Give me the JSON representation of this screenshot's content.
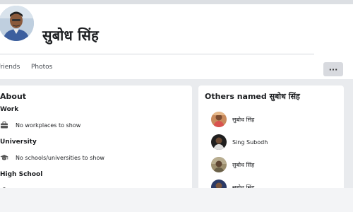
{
  "profile": {
    "name": "सुबोध सिंह"
  },
  "nav": {
    "friends_label": "Friends",
    "photos_label": "Photos",
    "more_label": "···"
  },
  "about": {
    "title": "About",
    "sections": [
      {
        "heading": "Work",
        "text": "No workplaces to show",
        "icon": "briefcase-icon"
      },
      {
        "heading": "University",
        "text": "No schools/universities to show",
        "icon": "graduation-cap-icon"
      },
      {
        "heading": "High School",
        "text": "",
        "icon": "graduation-cap-icon"
      }
    ]
  },
  "others": {
    "title": "Others named सुबोध सिंह",
    "people": [
      {
        "name": "सुबोध सिंह"
      },
      {
        "name": "Sing Subodh"
      },
      {
        "name": "सुबोध सिंह"
      },
      {
        "name": "सुबोध सिंह"
      }
    ]
  },
  "colors": {
    "background": "#e9ebee",
    "card": "#ffffff",
    "text": "#1c1e21"
  }
}
